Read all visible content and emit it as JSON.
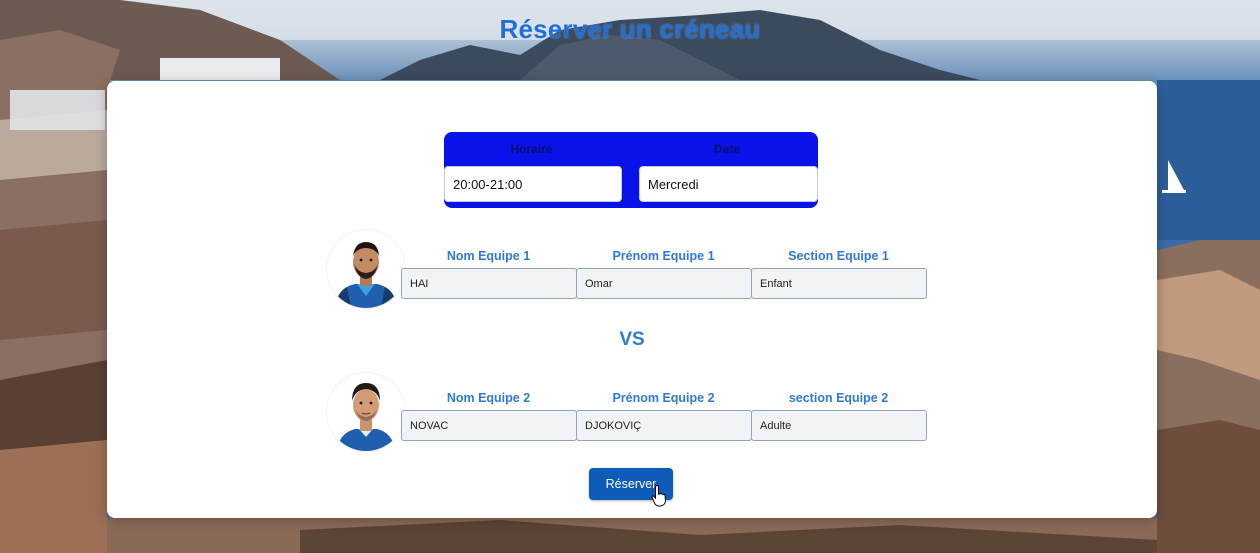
{
  "page": {
    "title": "Réserver un créneau"
  },
  "slot": {
    "horaire_label": "Horaire",
    "date_label": "Date",
    "horaire_value": "20:00-21:00",
    "date_value": "Mercredi"
  },
  "team1": {
    "nom_label": "Nom Equipe 1",
    "prenom_label": "Prénom Equipe 1",
    "section_label": "Section Equipe 1",
    "nom_value": "HAI",
    "prenom_value": "Omar",
    "section_value": "Enfant"
  },
  "versus": "VS",
  "team2": {
    "nom_label": "Nom Equipe 2",
    "prenom_label": "Prénom Equipe 2",
    "section_label": "section Equipe 2",
    "nom_value": "NOVAC",
    "prenom_value": "DJOKOVIÇ",
    "section_value": "Adulte"
  },
  "actions": {
    "submit_label": "Réserver"
  },
  "icons": {
    "cursor": "hand-pointer-icon",
    "avatar1": "player-avatar-icon",
    "avatar2": "player-avatar-icon"
  },
  "colors": {
    "accent": "#2f7ad6",
    "slot_box": "#0a12ea",
    "button": "#0f5bb8",
    "title": "#1f6fd6"
  }
}
